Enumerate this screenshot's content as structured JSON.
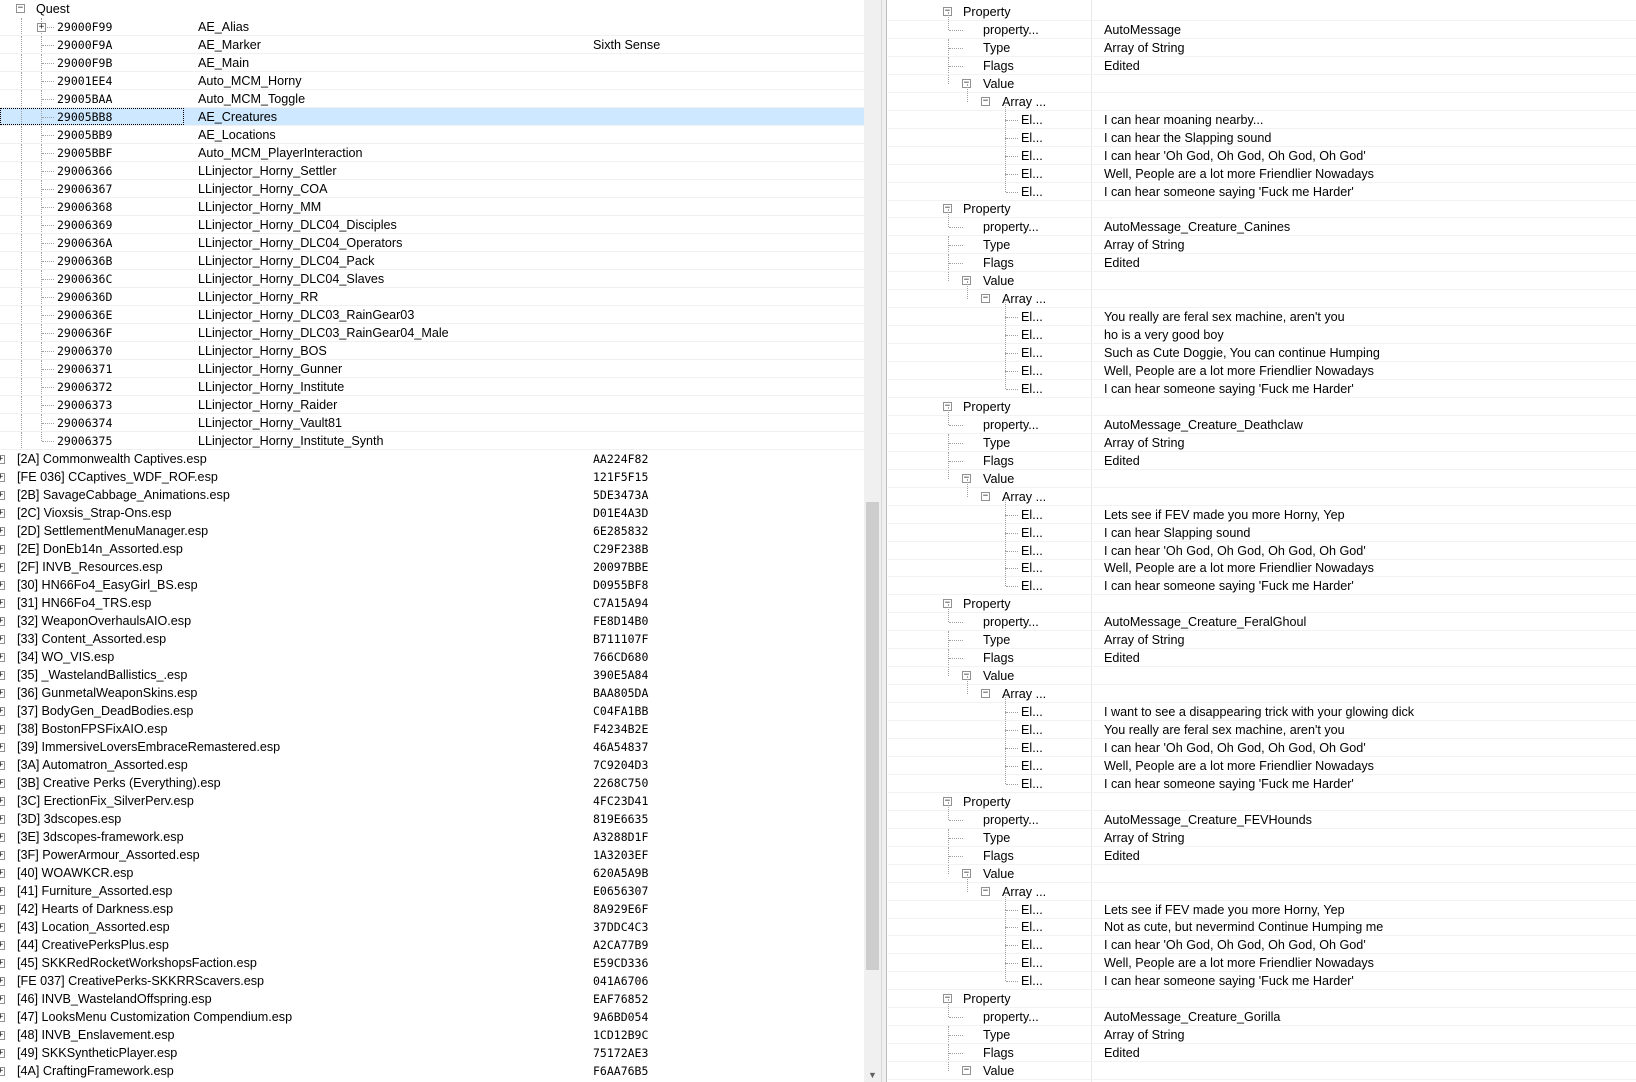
{
  "left_panel": {
    "quest_label": "Quest",
    "quest_items": [
      {
        "id": "29000F99",
        "name": "AE_Alias",
        "extra": "",
        "expandable": true
      },
      {
        "id": "29000F9A",
        "name": "AE_Marker",
        "extra": "Sixth Sense"
      },
      {
        "id": "29000F9B",
        "name": "AE_Main",
        "extra": ""
      },
      {
        "id": "29001EE4",
        "name": "Auto_MCM_Horny",
        "extra": ""
      },
      {
        "id": "29005BAA",
        "name": "Auto_MCM_Toggle",
        "extra": ""
      },
      {
        "id": "29005BB8",
        "name": "AE_Creatures",
        "extra": "",
        "selected": true
      },
      {
        "id": "29005BB9",
        "name": "AE_Locations",
        "extra": ""
      },
      {
        "id": "29005BBF",
        "name": "Auto_MCM_PlayerInteraction",
        "extra": ""
      },
      {
        "id": "29006366",
        "name": "LLinjector_Horny_Settler",
        "extra": ""
      },
      {
        "id": "29006367",
        "name": "LLinjector_Horny_COA",
        "extra": ""
      },
      {
        "id": "29006368",
        "name": "LLinjector_Horny_MM",
        "extra": ""
      },
      {
        "id": "29006369",
        "name": "LLinjector_Horny_DLC04_Disciples",
        "extra": ""
      },
      {
        "id": "2900636A",
        "name": "LLinjector_Horny_DLC04_Operators",
        "extra": ""
      },
      {
        "id": "2900636B",
        "name": "LLinjector_Horny_DLC04_Pack",
        "extra": ""
      },
      {
        "id": "2900636C",
        "name": "LLinjector_Horny_DLC04_Slaves",
        "extra": ""
      },
      {
        "id": "2900636D",
        "name": "LLinjector_Horny_RR",
        "extra": ""
      },
      {
        "id": "2900636E",
        "name": "LLinjector_Horny_DLC03_RainGear03",
        "extra": ""
      },
      {
        "id": "2900636F",
        "name": "LLinjector_Horny_DLC03_RainGear04_Male",
        "extra": ""
      },
      {
        "id": "29006370",
        "name": "LLinjector_Horny_BOS",
        "extra": ""
      },
      {
        "id": "29006371",
        "name": "LLinjector_Horny_Gunner",
        "extra": ""
      },
      {
        "id": "29006372",
        "name": "LLinjector_Horny_Institute",
        "extra": ""
      },
      {
        "id": "29006373",
        "name": "LLinjector_Horny_Raider",
        "extra": ""
      },
      {
        "id": "29006374",
        "name": "LLinjector_Horny_Vault81",
        "extra": ""
      },
      {
        "id": "29006375",
        "name": "LLinjector_Horny_Institute_Synth",
        "extra": ""
      }
    ],
    "plugins": [
      {
        "name": "[2A] Commonwealth Captives.esp",
        "crc": "AA224F82"
      },
      {
        "name": "[FE 036] CCaptives_WDF_ROF.esp",
        "crc": "121F5F15"
      },
      {
        "name": "[2B] SavageCabbage_Animations.esp",
        "crc": "5DE3473A"
      },
      {
        "name": "[2C] Vioxsis_Strap-Ons.esp",
        "crc": "D01E4A3D"
      },
      {
        "name": "[2D] SettlementMenuManager.esp",
        "crc": "6E285832"
      },
      {
        "name": "[2E] DonEb14n_Assorted.esp",
        "crc": "C29F238B"
      },
      {
        "name": "[2F] INVB_Resources.esp",
        "crc": "20097BBE"
      },
      {
        "name": "[30] HN66Fo4_EasyGirl_BS.esp",
        "crc": "D0955BF8"
      },
      {
        "name": "[31] HN66Fo4_TRS.esp",
        "crc": "C7A15A94"
      },
      {
        "name": "[32] WeaponOverhaulsAIO.esp",
        "crc": "FE8D14B0"
      },
      {
        "name": "[33] Content_Assorted.esp",
        "crc": "B711107F"
      },
      {
        "name": "[34] WO_VIS.esp",
        "crc": "766CD680"
      },
      {
        "name": "[35] _WastelandBallistics_.esp",
        "crc": "390E5A84"
      },
      {
        "name": "[36] GunmetalWeaponSkins.esp",
        "crc": "BAA805DA"
      },
      {
        "name": "[37] BodyGen_DeadBodies.esp",
        "crc": "C04FA1BB"
      },
      {
        "name": "[38] BostonFPSFixAIO.esp",
        "crc": "F4234B2E"
      },
      {
        "name": "[39] ImmersiveLoversEmbraceRemastered.esp",
        "crc": "46A54837"
      },
      {
        "name": "[3A] Automatron_Assorted.esp",
        "crc": "7C9204D3"
      },
      {
        "name": "[3B] Creative Perks (Everything).esp",
        "crc": "2268C750"
      },
      {
        "name": "[3C] ErectionFix_SilverPerv.esp",
        "crc": "4FC23D41"
      },
      {
        "name": "[3D] 3dscopes.esp",
        "crc": "819E6635"
      },
      {
        "name": "[3E] 3dscopes-framework.esp",
        "crc": "A3288D1F"
      },
      {
        "name": "[3F] PowerArmour_Assorted.esp",
        "crc": "1A3203EF"
      },
      {
        "name": "[40] WOAWKCR.esp",
        "crc": "620A5A9B"
      },
      {
        "name": "[41] Furniture_Assorted.esp",
        "crc": "E0656307"
      },
      {
        "name": "[42] Hearts of Darkness.esp",
        "crc": "8A929E6F"
      },
      {
        "name": "[43] Location_Assorted.esp",
        "crc": "37DDC4C3"
      },
      {
        "name": "[44] CreativePerksPlus.esp",
        "crc": "A2CA77B9"
      },
      {
        "name": "[45] SKKRedRocketWorkshopsFaction.esp",
        "crc": "E59CD336"
      },
      {
        "name": "[FE 037] CreativePerks-SKKRRScavers.esp",
        "crc": "041A6706"
      },
      {
        "name": "[46] INVB_WastelandOffspring.esp",
        "crc": "EAF76852"
      },
      {
        "name": "[47] LooksMenu Customization Compendium.esp",
        "crc": "9A6BD054"
      },
      {
        "name": "[48] INVB_Enslavement.esp",
        "crc": "1CD12B9C"
      },
      {
        "name": "[49] SKKSyntheticPlayer.esp",
        "crc": "75172AE3"
      },
      {
        "name": "[4A] CraftingFramework.esp",
        "crc": "F6AA76B5"
      }
    ]
  },
  "right_panel": {
    "labels": {
      "property": "Property",
      "property_name": "property...",
      "type": "Type",
      "flags": "Flags",
      "value": "Value",
      "array": "Array ...",
      "element": "El..."
    },
    "properties": [
      {
        "name": "AutoMessage",
        "type": "Array of String",
        "flags": "Edited",
        "elements": [
          "I can hear moaning nearby...",
          "I can hear the Slapping sound",
          "I can hear 'Oh God, Oh God, Oh God, Oh God'",
          "Well, People are a lot more Friendlier Nowadays",
          "I can hear someone saying 'Fuck me Harder'"
        ]
      },
      {
        "name": "AutoMessage_Creature_Canines",
        "type": "Array of String",
        "flags": "Edited",
        "elements": [
          "You really are feral sex machine, aren't you",
          "ho is a very good boy",
          "Such as Cute Doggie, You can continue Humping",
          "Well, People are a lot more Friendlier Nowadays",
          "I can hear someone saying 'Fuck me Harder'"
        ]
      },
      {
        "name": "AutoMessage_Creature_Deathclaw",
        "type": "Array of String",
        "flags": "Edited",
        "elements": [
          "Lets see if FEV made you more Horny, Yep",
          "I can hear Slapping sound",
          "I can hear 'Oh God, Oh God, Oh God, Oh God'",
          "Well, People are a lot more Friendlier Nowadays",
          "I can hear someone saying 'Fuck me Harder'"
        ]
      },
      {
        "name": "AutoMessage_Creature_FeralGhoul",
        "type": "Array of String",
        "flags": "Edited",
        "elements": [
          "I want to see a disappearing trick with your glowing dick",
          "You really are feral sex machine, aren't you",
          "I can hear 'Oh God, Oh God, Oh God, Oh God'",
          "Well, People are a lot more Friendlier Nowadays",
          "I can hear someone saying 'Fuck me Harder'"
        ]
      },
      {
        "name": "AutoMessage_Creature_FEVHounds",
        "type": "Array of String",
        "flags": "Edited",
        "elements": [
          "Lets see if FEV made you more Horny, Yep",
          "Not as cute, but nevermind Continue Humping me",
          "I can hear 'Oh God, Oh God, Oh God, Oh God'",
          "Well, People are a lot more Friendlier Nowadays",
          "I can hear someone saying 'Fuck me Harder'"
        ]
      },
      {
        "name": "AutoMessage_Creature_Gorilla",
        "type": "Array of String",
        "flags": "Edited",
        "elements": []
      }
    ]
  }
}
